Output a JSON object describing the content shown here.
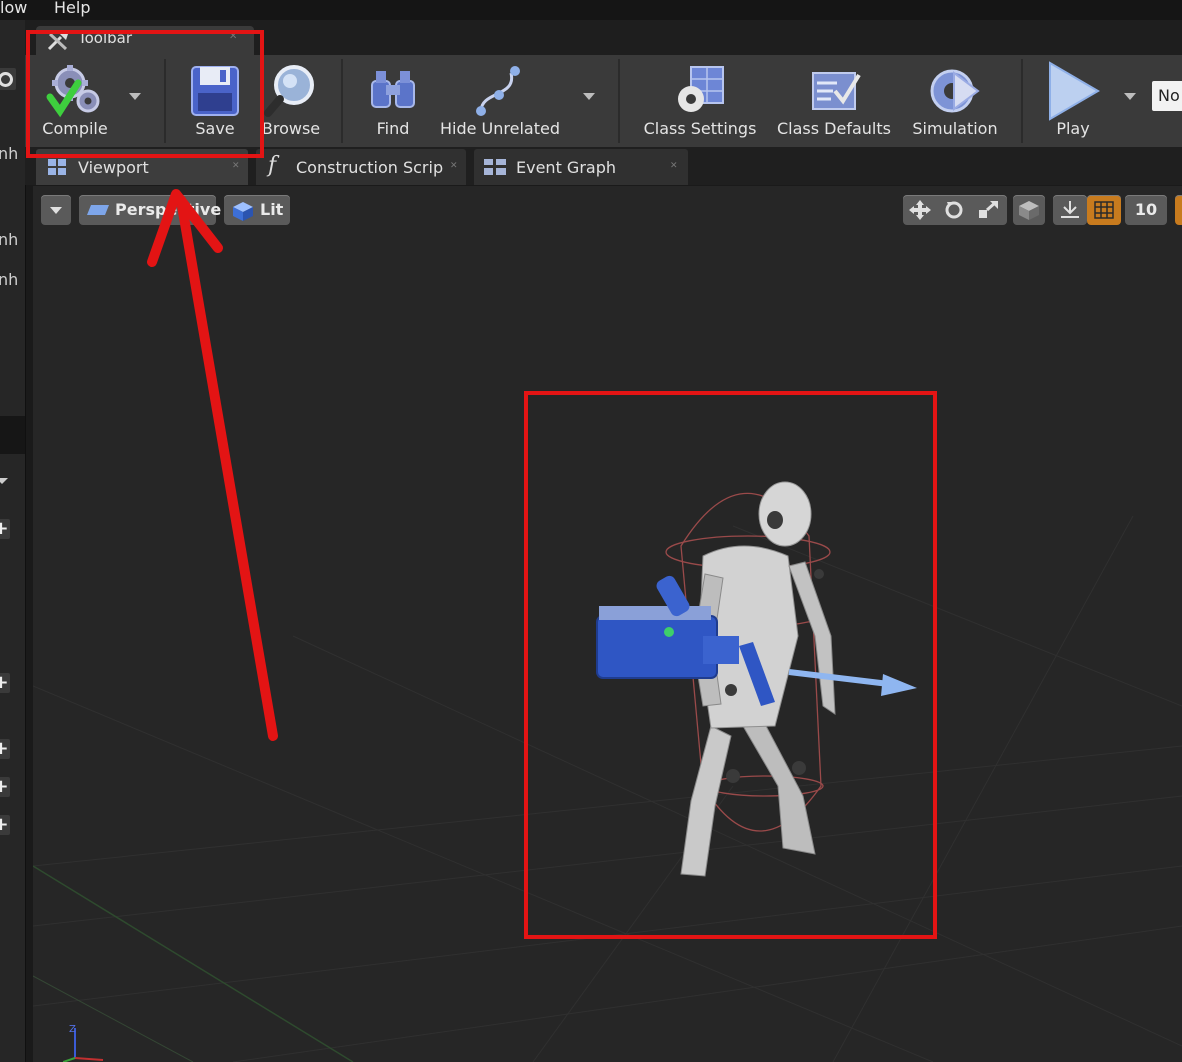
{
  "menu": {
    "window": "low",
    "help": "Help"
  },
  "left_panel": {
    "label_1": "nh",
    "label_2": "nh",
    "label_3": "nh"
  },
  "toolbar_tab": {
    "label": "Toolbar"
  },
  "toolbar": {
    "compile": "Compile",
    "save": "Save",
    "browse": "Browse",
    "find": "Find",
    "hide_unrelated": "Hide Unrelated",
    "class_settings": "Class Settings",
    "class_defaults": "Class Defaults",
    "simulation": "Simulation",
    "play": "Play",
    "debug_filter": "No"
  },
  "doc_tabs": {
    "viewport": "Viewport",
    "construction_script": "Construction Scrip",
    "event_graph": "Event Graph"
  },
  "viewport_toolbar": {
    "perspective": "Perspective",
    "lit": "Lit",
    "grid_snap": "10"
  },
  "colors": {
    "highlight_red": "#e31414",
    "toolbar_bg": "#3a3a3a",
    "viewport_bg": "#262626",
    "accent_orange": "#c87b1e"
  }
}
